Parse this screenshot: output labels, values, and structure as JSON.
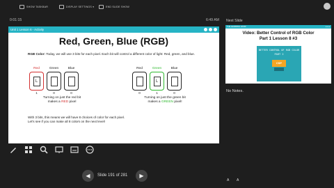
{
  "toolbar": {
    "show_taskbar": "SHOW TASKBAR",
    "display_settings": "DISPLAY SETTINGS ▾",
    "end_slide_show": "END SLIDE SHOW"
  },
  "presenter": {
    "timer": "0:01:15",
    "clock": "6:49 AM",
    "next_slide_label": "Next Slide",
    "notes": "No Notes."
  },
  "slide": {
    "header": "Unit 1 Lesson 6 - Activity",
    "title": "Red, Green, Blue (RGB)",
    "intro_bold": "RGB Color:",
    "intro_text": " Today, we will use 3 bits for each pixel. Each bit will control a different color of light: Red, green, and blue.",
    "left_bits": [
      {
        "label": "Red",
        "switch": "L",
        "value": "1",
        "color": "#d32f2f",
        "label_color": "#d32f2f"
      },
      {
        "label": "Green",
        "switch": "",
        "value": "0",
        "color": "#222222",
        "label_color": "#222222"
      },
      {
        "label": "Blue",
        "switch": "",
        "value": "0",
        "color": "#222222",
        "label_color": "#222222"
      }
    ],
    "right_bits": [
      {
        "label": "Red",
        "switch": "",
        "value": "0",
        "color": "#222222",
        "label_color": "#222222"
      },
      {
        "label": "Green",
        "switch": "L",
        "value": "1",
        "color": "#2eb82e",
        "label_color": "#2eb82e"
      },
      {
        "label": "Blue",
        "switch": "",
        "value": "0",
        "color": "#222222",
        "label_color": "#222222"
      }
    ],
    "left_caption_1": "Turning on just the red bit",
    "left_caption_2a": "makes a ",
    "left_caption_2b": "RED",
    "left_caption_2c": " pixel",
    "right_caption_1": "Turning on just the green bit",
    "right_caption_2a": "makes a ",
    "right_caption_2b": "GREEN",
    "right_caption_2c": " pixel!",
    "outro_1": "With 3 bits, this means we will have 8 choices of color for each pixel.",
    "outro_2": "Let's see if you can make all 8 colors on the next level!"
  },
  "next_slide": {
    "header": "THE LEARNING HOUR",
    "title_1": "Video:  Better Control of RGB Color",
    "title_2": "Part 1 Lesson 8 #3",
    "video_line_1": "BETTER CONTROL OF RGB COLOR",
    "video_line_2": "PART 2",
    "video_logo": "CSP"
  },
  "nav": {
    "slide_counter": "Slide 191 of 281"
  },
  "colors": {
    "accent": "#26b4c5",
    "red": "#d32f2f",
    "green": "#2eb82e"
  }
}
